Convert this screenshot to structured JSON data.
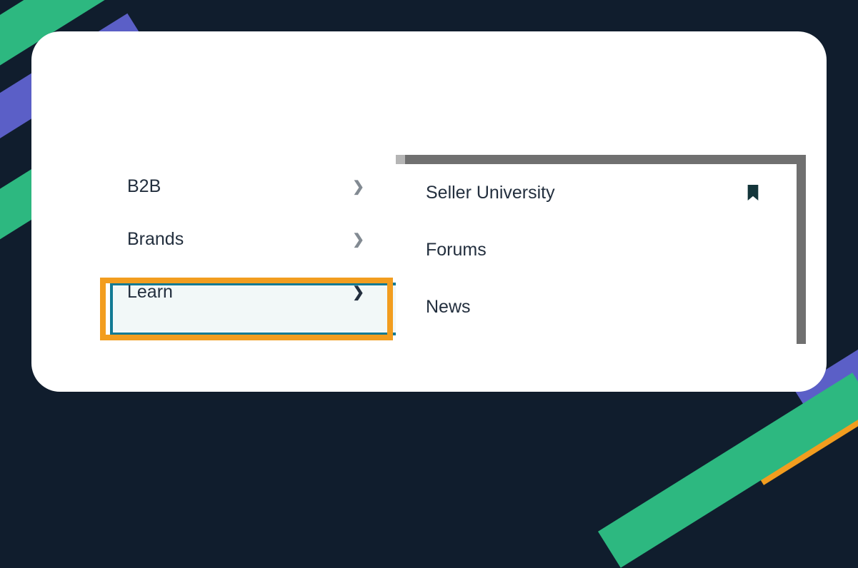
{
  "menu": {
    "items": [
      {
        "label": "B2B"
      },
      {
        "label": "Brands"
      },
      {
        "label": "Learn"
      }
    ]
  },
  "submenu": {
    "items": [
      {
        "label": "Seller University",
        "bookmarked": true
      },
      {
        "label": "Forums"
      },
      {
        "label": "News"
      }
    ]
  }
}
